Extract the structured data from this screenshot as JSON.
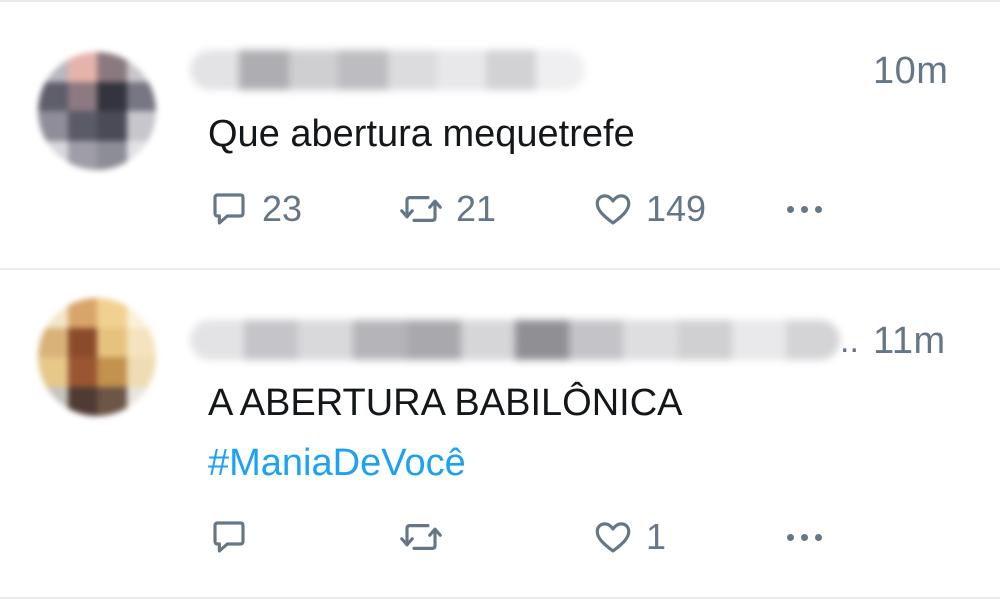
{
  "tweets": [
    {
      "time": "10m",
      "text": "Que abertura mequetrefe",
      "hashtag": "",
      "replies": "23",
      "retweets": "21",
      "likes": "149",
      "icons": {
        "reply": "reply-icon",
        "retweet": "retweet-icon",
        "like": "heart-icon",
        "more": "more-icon"
      }
    },
    {
      "time": "11m",
      "name_truncation": "..",
      "text": "A ABERTURA BABILÔNICA",
      "hashtag": "#ManiaDeVocê",
      "replies": "",
      "retweets": "",
      "likes": "1",
      "icons": {
        "reply": "reply-icon",
        "retweet": "retweet-icon",
        "like": "heart-icon",
        "more": "more-icon"
      }
    }
  ],
  "colors": {
    "text": "#14171a",
    "secondary": "#657786",
    "link": "#1da1f2",
    "divider": "#e6ecf0"
  }
}
